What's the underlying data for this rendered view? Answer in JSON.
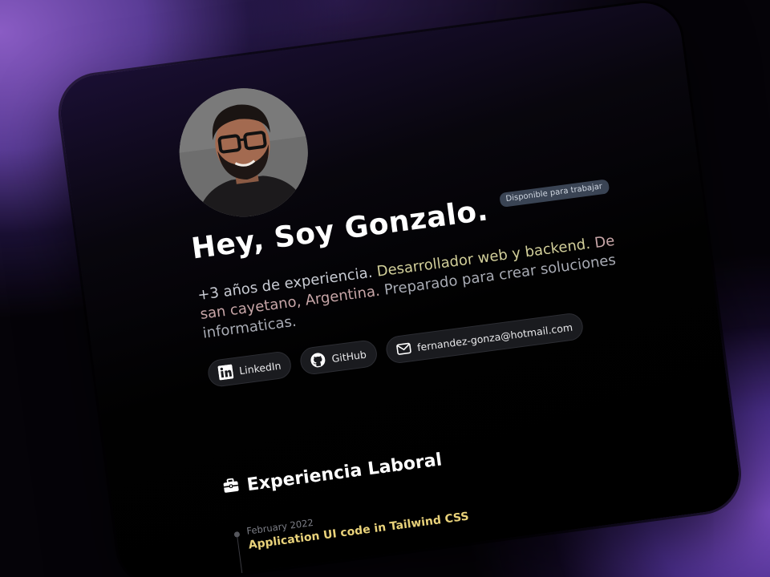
{
  "profile": {
    "name_heading": "Hey, Soy Gonzalo.",
    "status_badge": "Disponible para trabajar",
    "bio": {
      "part1": "+3 años de experiencia. ",
      "part2": "Desarrollador web y backend.",
      "part3": " De san cayetano, Argentina.",
      "part4": " Preparado para crear soluciones informaticas."
    }
  },
  "links": [
    {
      "label": "LinkedIn",
      "icon": "linkedin-icon"
    },
    {
      "label": "GitHub",
      "icon": "github-icon"
    },
    {
      "label": "fernandez-gonza@hotmail.com",
      "icon": "mail-icon"
    }
  ],
  "experience": {
    "section_title": "Experiencia Laboral",
    "section_icon": "briefcase-icon",
    "items": [
      {
        "date": "February 2022",
        "title": "Application UI code in Tailwind CSS"
      }
    ]
  },
  "colors": {
    "accent_yellow": "#d2cf9a",
    "accent_rose": "#c8a6a8",
    "timeline_title": "#e9d27a",
    "badge_bg": "#3a4454"
  }
}
